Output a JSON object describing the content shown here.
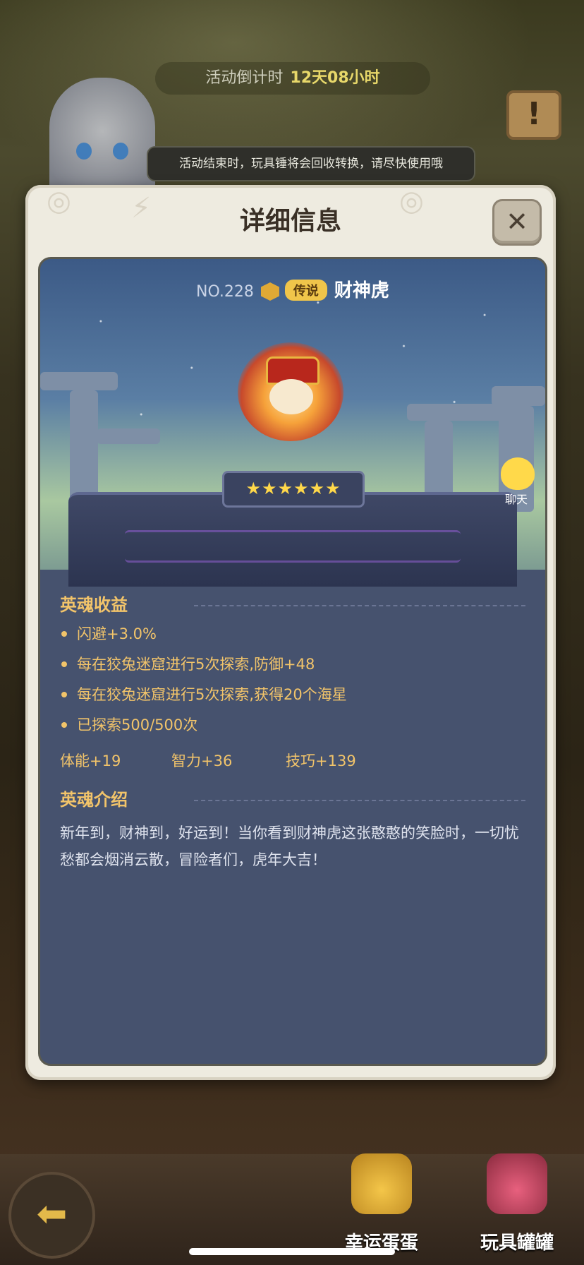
{
  "event": {
    "countdown_label": "活动倒计时",
    "countdown_value": "12天08小时",
    "tip": "活动结束时，玩具锤将会回收转换，请尽快使用哦"
  },
  "modal": {
    "title": "详细信息",
    "close_icon": "close-icon",
    "pet": {
      "number": "NO.228",
      "rarity": "传说",
      "name": "财神虎",
      "stars": "★★★★★★",
      "star_count": 6
    },
    "benefits": {
      "title": "英魂收益",
      "items": [
        "闪避+3.0%",
        "每在狡兔迷窟进行5次探索,防御+48",
        "每在狡兔迷窟进行5次探索,获得20个海星",
        "已探索500/500次"
      ],
      "attributes": [
        "体能+19",
        "智力+36",
        "技巧+139"
      ]
    },
    "intro": {
      "title": "英魂介绍",
      "text": "新年到，财神到，好运到！当你看到财神虎这张憨憨的笑脸时，一切忧愁都会烟消云散，冒险者们，虎年大吉！"
    }
  },
  "chat": {
    "label": "聊天",
    "icon": "chat-smiley-icon"
  },
  "nav": {
    "back_icon": "back-arrow-icon",
    "items": [
      {
        "label": "幸运蛋蛋",
        "icon": "golden-egg-hammer-icon"
      },
      {
        "label": "玩具罐罐",
        "icon": "toy-jar-icon"
      }
    ]
  },
  "colors": {
    "accent": "#f2c46a",
    "panel": "#46526e",
    "rarity": "#f0c54a"
  }
}
